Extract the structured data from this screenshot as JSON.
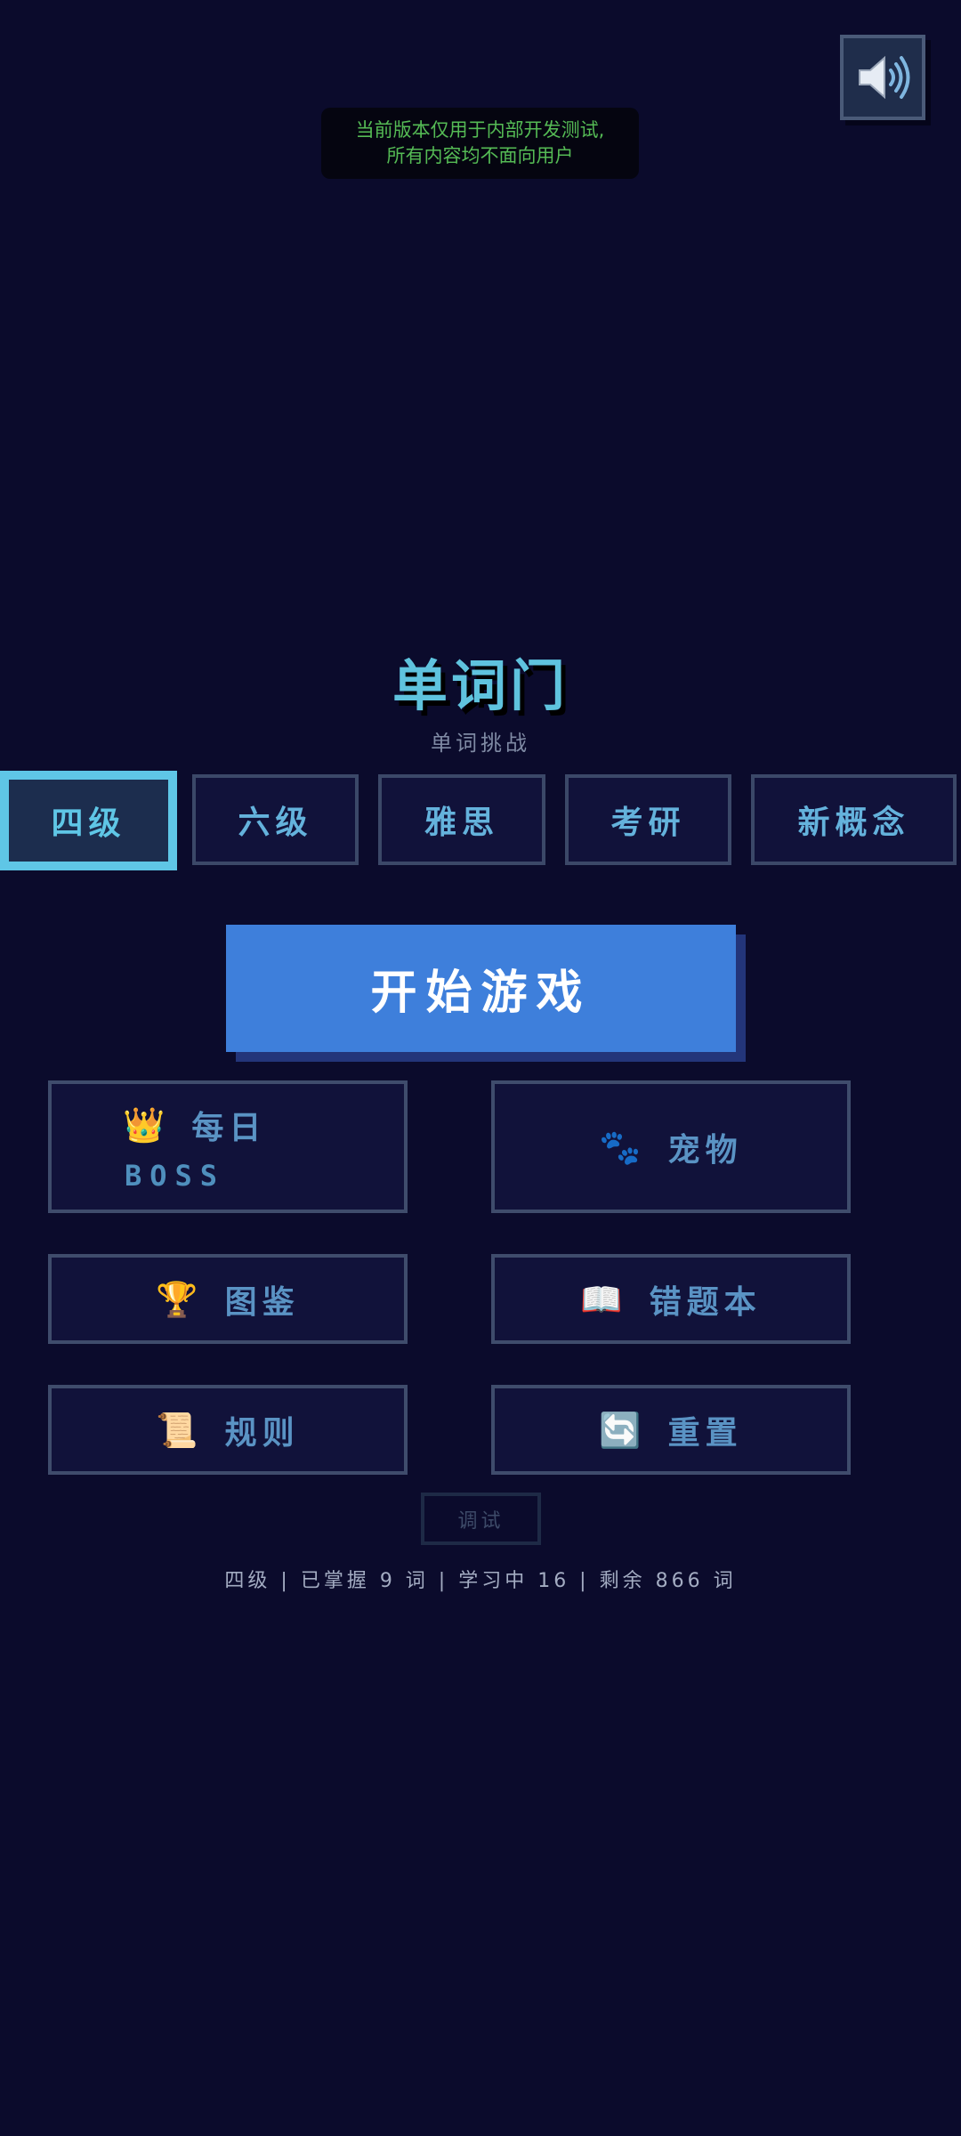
{
  "notice": {
    "line1": "当前版本仅用于内部开发测试,",
    "line2": "所有内容均不面向用户"
  },
  "header": {
    "title": "单词门",
    "subtitle": "单词挑战"
  },
  "levels": [
    {
      "label": "四级",
      "selected": true
    },
    {
      "label": "六级",
      "selected": false
    },
    {
      "label": "雅思",
      "selected": false
    },
    {
      "label": "考研",
      "selected": false
    },
    {
      "label": "新概念",
      "selected": false
    }
  ],
  "start_button": {
    "label": "开始游戏"
  },
  "menu": {
    "daily_boss": {
      "icon": "👑",
      "label": "每日",
      "label2": "BOSS"
    },
    "pet": {
      "icon": "🐾",
      "label": "宠物"
    },
    "collection": {
      "icon": "🏆",
      "label": "图鉴"
    },
    "mistakes": {
      "icon": "📖",
      "label": "错题本"
    },
    "rules": {
      "icon": "📜",
      "label": "规则"
    },
    "reset": {
      "icon": "🔄",
      "label": "重置"
    }
  },
  "debug_button": {
    "label": "调试"
  },
  "status_bar": {
    "text": "四级 | 已掌握 9 词 | 学习中 16 | 剩余 866 词"
  },
  "icons": {
    "sound": "speaker-icon"
  },
  "colors": {
    "background": "#0b0b2c",
    "accent": "#5fc6e6",
    "start_button": "#3e7fdb",
    "notice_text": "#55bb55"
  }
}
